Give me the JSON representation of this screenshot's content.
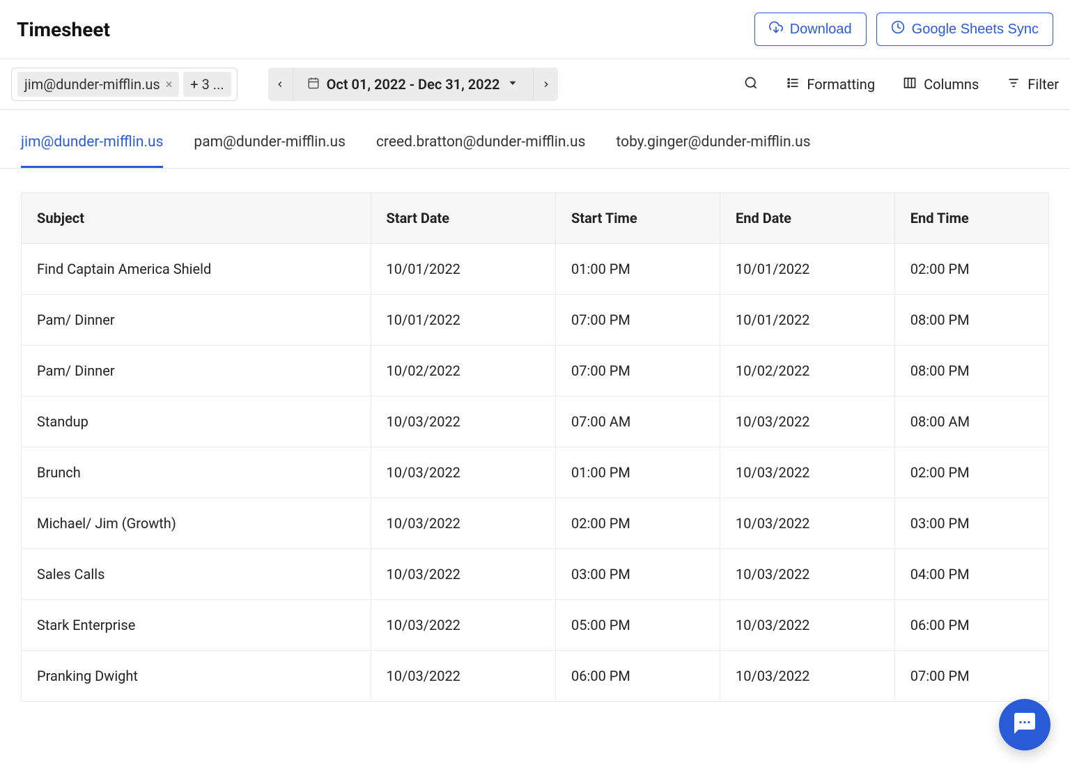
{
  "header": {
    "title": "Timesheet",
    "download_label": "Download",
    "sheets_sync_label": "Google Sheets Sync"
  },
  "toolbar": {
    "filter_chip_email": "jim@dunder-mifflin.us",
    "filter_chip_more": "+ 3 ...",
    "date_range": "Oct 01, 2022 - Dec 31, 2022",
    "formatting_label": "Formatting",
    "columns_label": "Columns",
    "filter_label": "Filter"
  },
  "tabs": [
    {
      "label": "jim@dunder-mifflin.us",
      "active": true
    },
    {
      "label": "pam@dunder-mifflin.us",
      "active": false
    },
    {
      "label": "creed.bratton@dunder-mifflin.us",
      "active": false
    },
    {
      "label": "toby.ginger@dunder-mifflin.us",
      "active": false
    }
  ],
  "table": {
    "headers": {
      "subject": "Subject",
      "start_date": "Start Date",
      "start_time": "Start Time",
      "end_date": "End Date",
      "end_time": "End Time"
    },
    "rows": [
      {
        "subject": "Find Captain America Shield",
        "start_date": "10/01/2022",
        "start_time": "01:00 PM",
        "end_date": "10/01/2022",
        "end_time": "02:00 PM"
      },
      {
        "subject": "Pam/ Dinner",
        "start_date": "10/01/2022",
        "start_time": "07:00 PM",
        "end_date": "10/01/2022",
        "end_time": "08:00 PM"
      },
      {
        "subject": "Pam/ Dinner",
        "start_date": "10/02/2022",
        "start_time": "07:00 PM",
        "end_date": "10/02/2022",
        "end_time": "08:00 PM"
      },
      {
        "subject": "Standup",
        "start_date": "10/03/2022",
        "start_time": "07:00 AM",
        "end_date": "10/03/2022",
        "end_time": "08:00 AM"
      },
      {
        "subject": "Brunch",
        "start_date": "10/03/2022",
        "start_time": "01:00 PM",
        "end_date": "10/03/2022",
        "end_time": "02:00 PM"
      },
      {
        "subject": "Michael/ Jim (Growth)",
        "start_date": "10/03/2022",
        "start_time": "02:00 PM",
        "end_date": "10/03/2022",
        "end_time": "03:00 PM"
      },
      {
        "subject": "Sales Calls",
        "start_date": "10/03/2022",
        "start_time": "03:00 PM",
        "end_date": "10/03/2022",
        "end_time": "04:00 PM"
      },
      {
        "subject": "Stark Enterprise",
        "start_date": "10/03/2022",
        "start_time": "05:00 PM",
        "end_date": "10/03/2022",
        "end_time": "06:00 PM"
      },
      {
        "subject": "Pranking Dwight",
        "start_date": "10/03/2022",
        "start_time": "06:00 PM",
        "end_date": "10/03/2022",
        "end_time": "07:00 PM"
      }
    ]
  }
}
